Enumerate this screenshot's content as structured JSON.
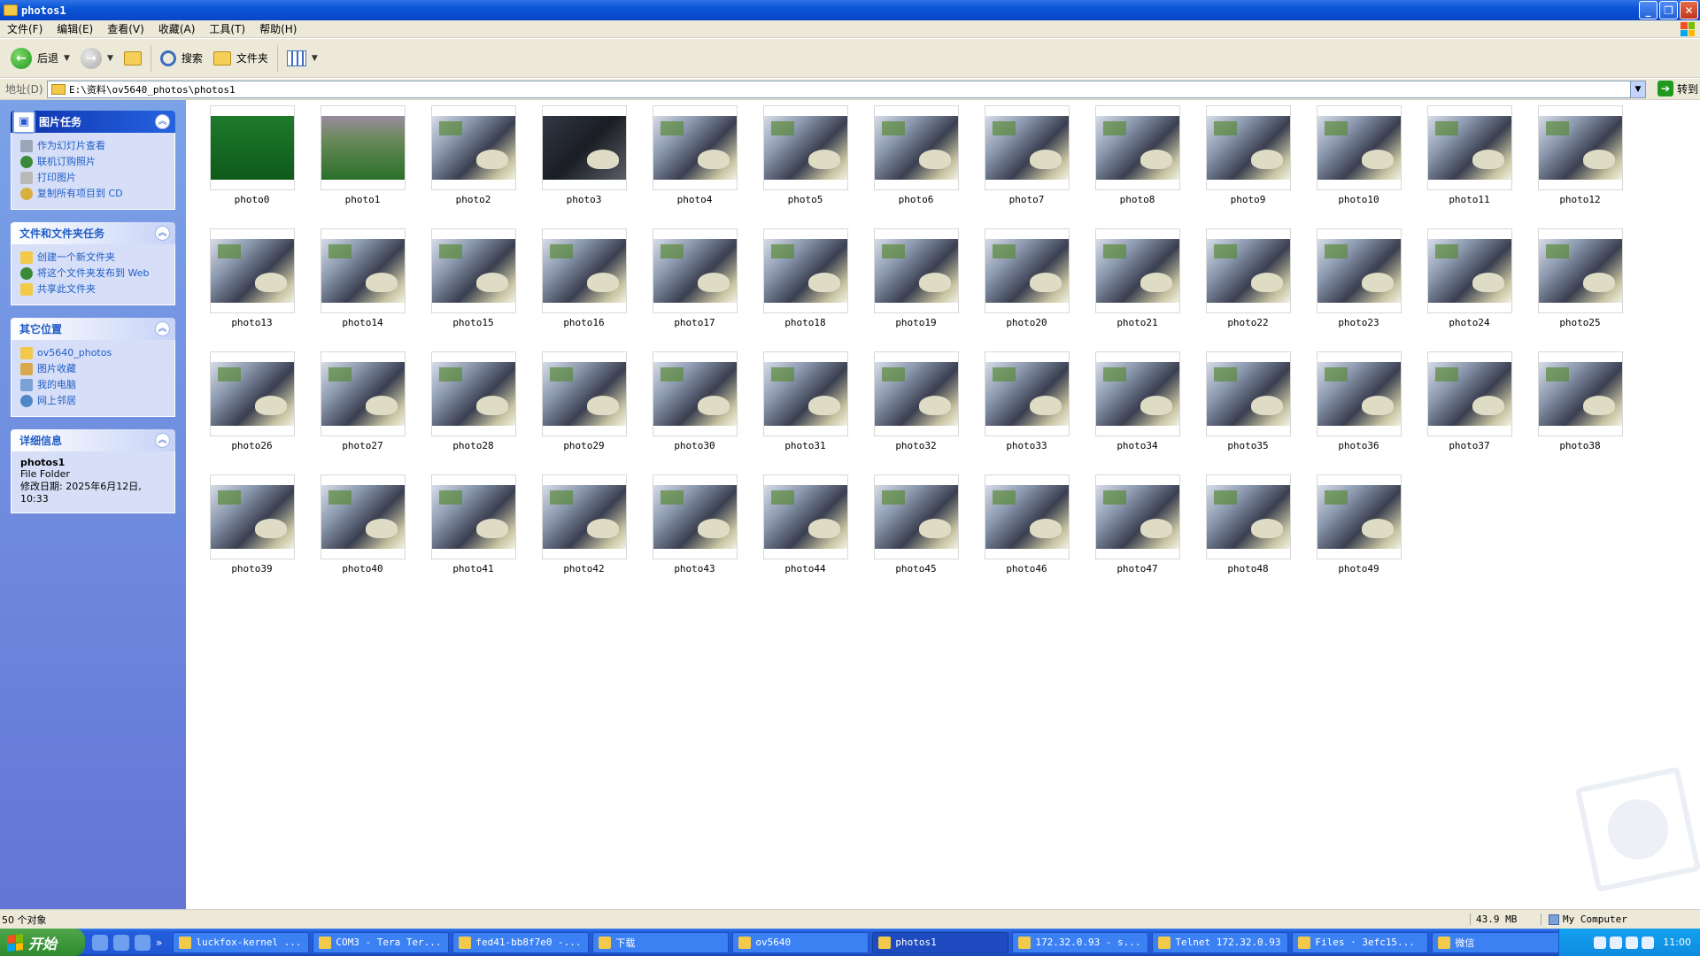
{
  "window": {
    "title": "photos1"
  },
  "menu": [
    "文件(F)",
    "编辑(E)",
    "查看(V)",
    "收藏(A)",
    "工具(T)",
    "帮助(H)"
  ],
  "toolbar": {
    "back_label": "后退",
    "search_label": "搜索",
    "folders_label": "文件夹"
  },
  "address": {
    "label": "地址(D)",
    "path": "E:\\资料\\ov5640_photos\\photos1",
    "go_label": "转到"
  },
  "tasks_panel": {
    "title": "图片任务",
    "items": [
      "作为幻灯片查看",
      "联机订购照片",
      "打印图片",
      "复制所有项目到 CD"
    ]
  },
  "file_panel": {
    "title": "文件和文件夹任务",
    "items": [
      "创建一个新文件夹",
      "将这个文件夹发布到 Web",
      "共享此文件夹"
    ]
  },
  "places_panel": {
    "title": "其它位置",
    "items": [
      "ov5640_photos",
      "图片收藏",
      "我的电脑",
      "网上邻居"
    ]
  },
  "details_panel": {
    "title": "详细信息",
    "name": "photos1",
    "type": "File Folder",
    "modified": "修改日期: 2025年6月12日, 10:33"
  },
  "files": [
    {
      "name": "photo0",
      "kind": "green"
    },
    {
      "name": "photo1",
      "kind": "field"
    },
    {
      "name": "photo2",
      "kind": "desk"
    },
    {
      "name": "photo3",
      "kind": "dark"
    },
    {
      "name": "photo4",
      "kind": "desk"
    },
    {
      "name": "photo5",
      "kind": "desk"
    },
    {
      "name": "photo6",
      "kind": "desk"
    },
    {
      "name": "photo7",
      "kind": "desk"
    },
    {
      "name": "photo8",
      "kind": "desk"
    },
    {
      "name": "photo9",
      "kind": "desk"
    },
    {
      "name": "photo10",
      "kind": "desk"
    },
    {
      "name": "photo11",
      "kind": "desk"
    },
    {
      "name": "photo12",
      "kind": "desk"
    },
    {
      "name": "photo13",
      "kind": "desk"
    },
    {
      "name": "photo14",
      "kind": "desk"
    },
    {
      "name": "photo15",
      "kind": "desk"
    },
    {
      "name": "photo16",
      "kind": "desk"
    },
    {
      "name": "photo17",
      "kind": "desk"
    },
    {
      "name": "photo18",
      "kind": "desk"
    },
    {
      "name": "photo19",
      "kind": "desk"
    },
    {
      "name": "photo20",
      "kind": "desk"
    },
    {
      "name": "photo21",
      "kind": "desk"
    },
    {
      "name": "photo22",
      "kind": "desk"
    },
    {
      "name": "photo23",
      "kind": "desk"
    },
    {
      "name": "photo24",
      "kind": "desk"
    },
    {
      "name": "photo25",
      "kind": "desk"
    },
    {
      "name": "photo26",
      "kind": "desk"
    },
    {
      "name": "photo27",
      "kind": "desk"
    },
    {
      "name": "photo28",
      "kind": "desk"
    },
    {
      "name": "photo29",
      "kind": "desk"
    },
    {
      "name": "photo30",
      "kind": "desk"
    },
    {
      "name": "photo31",
      "kind": "desk"
    },
    {
      "name": "photo32",
      "kind": "desk"
    },
    {
      "name": "photo33",
      "kind": "desk"
    },
    {
      "name": "photo34",
      "kind": "desk"
    },
    {
      "name": "photo35",
      "kind": "desk"
    },
    {
      "name": "photo36",
      "kind": "desk"
    },
    {
      "name": "photo37",
      "kind": "desk"
    },
    {
      "name": "photo38",
      "kind": "desk"
    },
    {
      "name": "photo39",
      "kind": "desk"
    },
    {
      "name": "photo40",
      "kind": "desk"
    },
    {
      "name": "photo41",
      "kind": "desk"
    },
    {
      "name": "photo42",
      "kind": "desk"
    },
    {
      "name": "photo43",
      "kind": "desk"
    },
    {
      "name": "photo44",
      "kind": "desk"
    },
    {
      "name": "photo45",
      "kind": "desk"
    },
    {
      "name": "photo46",
      "kind": "desk"
    },
    {
      "name": "photo47",
      "kind": "desk"
    },
    {
      "name": "photo48",
      "kind": "desk"
    },
    {
      "name": "photo49",
      "kind": "desk"
    }
  ],
  "status": {
    "count": "50 个对象",
    "size": "43.9 MB",
    "zone": "My Computer"
  },
  "taskbar": {
    "start_label": "开始",
    "tasks": [
      "luckfox-kernel ...",
      "COM3 - Tera Ter...",
      "fed41-bb8f7e0 -...",
      "下载",
      "ov5640",
      "photos1",
      "172.32.0.93 - s...",
      "Telnet 172.32.0.93",
      "Files · 3efc15...",
      "微信"
    ],
    "active_task": "photos1",
    "clock": "11:00"
  }
}
